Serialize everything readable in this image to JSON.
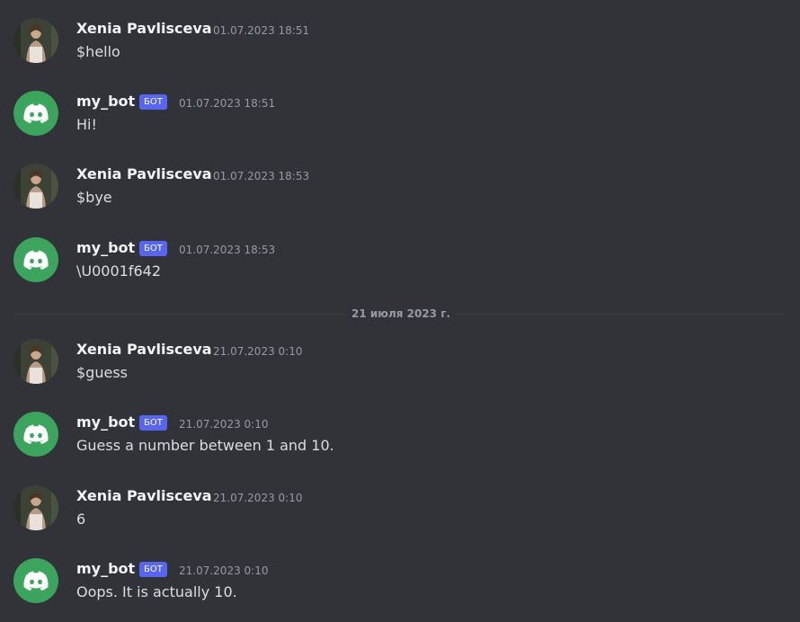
{
  "colors": {
    "background": "#313338",
    "username": "#f2f3f5",
    "message_text": "#dbdee1",
    "timestamp": "#949ba4",
    "bot_badge": "#5865f2",
    "bot_avatar": "#3ba55d"
  },
  "icons": {
    "bot_avatar": "discord-logo-icon",
    "user_avatar": "user-photo-avatar"
  },
  "date_divider": "21 июля 2023 г.",
  "messages": [
    {
      "author": "Xenia Pavlisceva",
      "is_bot": false,
      "badge": "",
      "timestamp": "01.07.2023 18:51",
      "text": "$hello"
    },
    {
      "author": "my_bot",
      "is_bot": true,
      "badge": "БОТ",
      "timestamp": "01.07.2023 18:51",
      "text": "Hi!"
    },
    {
      "author": "Xenia Pavlisceva",
      "is_bot": false,
      "badge": "",
      "timestamp": "01.07.2023 18:53",
      "text": "$bye"
    },
    {
      "author": "my_bot",
      "is_bot": true,
      "badge": "БОТ",
      "timestamp": "01.07.2023 18:53",
      "text": "\\U0001f642"
    },
    {
      "author": "Xenia Pavlisceva",
      "is_bot": false,
      "badge": "",
      "timestamp": "21.07.2023 0:10",
      "text": "$guess"
    },
    {
      "author": "my_bot",
      "is_bot": true,
      "badge": "БОТ",
      "timestamp": "21.07.2023 0:10",
      "text": "Guess a number between 1 and 10."
    },
    {
      "author": "Xenia Pavlisceva",
      "is_bot": false,
      "badge": "",
      "timestamp": "21.07.2023 0:10",
      "text": "6"
    },
    {
      "author": "my_bot",
      "is_bot": true,
      "badge": "БОТ",
      "timestamp": "21.07.2023 0:10",
      "text": "Oops. It is actually 10."
    }
  ]
}
